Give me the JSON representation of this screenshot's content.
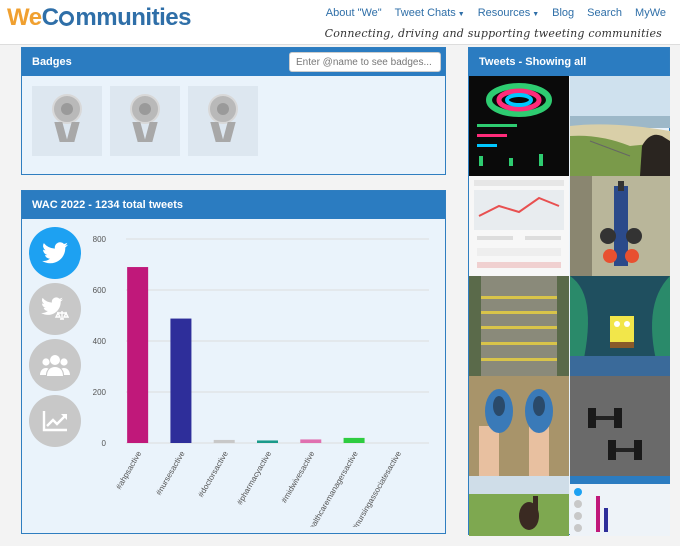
{
  "header": {
    "logo_we": "We",
    "logo_rest": "mmunities",
    "tagline": "Connecting, driving and supporting tweeting communities",
    "nav": [
      {
        "label": "About \"We\"",
        "dropdown": false
      },
      {
        "label": "Tweet Chats",
        "dropdown": true
      },
      {
        "label": "Resources",
        "dropdown": true
      },
      {
        "label": "Blog",
        "dropdown": false
      },
      {
        "label": "Search",
        "dropdown": false
      },
      {
        "label": "MyWe",
        "dropdown": false
      }
    ]
  },
  "badges": {
    "title": "Badges",
    "search_placeholder": "Enter @name to see badges...",
    "items": [
      "award-medal-icon",
      "award-medal-icon",
      "award-medal-icon"
    ]
  },
  "wac": {
    "title": "WAC 2022 - 1234 total tweets",
    "side_buttons": [
      {
        "icon": "twitter-icon",
        "active": true
      },
      {
        "icon": "twitter-scales-icon",
        "active": false
      },
      {
        "icon": "users-group-icon",
        "active": false
      },
      {
        "icon": "trend-chart-icon",
        "active": false
      }
    ]
  },
  "tweets": {
    "title": "Tweets - Showing all"
  },
  "colors": {
    "accent": "#2b7cc1",
    "active_button": "#1da1f2",
    "inactive_button": "#c8c8c8"
  },
  "chart_data": {
    "type": "bar",
    "categories": [
      "#ahpsactive",
      "#nursesactive",
      "#doctorsactive",
      "#pharmacyactive",
      "#midwivesactive",
      "#healthcaremanagersactive",
      "#nursingassociatesactive"
    ],
    "values": [
      690,
      488,
      12,
      10,
      14,
      20,
      0
    ],
    "colors": [
      "#c0187a",
      "#2e2e9a",
      "#c8c8c8",
      "#1a9a8a",
      "#e070b0",
      "#2ecc40",
      "#cccccc"
    ],
    "yticks": [
      0,
      200,
      400,
      600,
      800
    ],
    "ylim": [
      0,
      800
    ],
    "grid": true,
    "legend": "none"
  }
}
